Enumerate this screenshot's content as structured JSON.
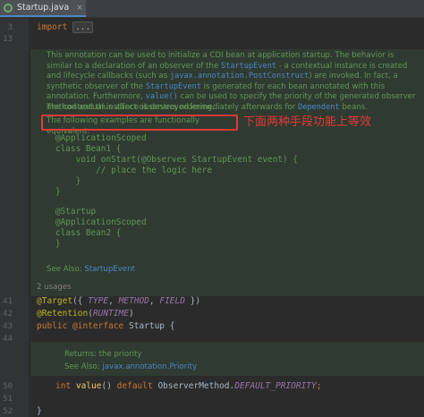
{
  "tab": {
    "label": "Startup.java",
    "close": "×"
  },
  "lines": {
    "l3": "3",
    "l13": "13",
    "l41": "41",
    "l42": "42",
    "l43": "43",
    "l44": "44",
    "l50": "50",
    "l51": "51",
    "l52": "52"
  },
  "code": {
    "import_kw": "import",
    "import_fold": "...",
    "target_ann": "@Target",
    "target_open": "({ ",
    "type": "TYPE",
    "comma1": ", ",
    "method": "METHOD",
    "comma2": ", ",
    "field": "FIELD",
    "target_close": " })",
    "retention_ann": "@Retention",
    "retention_open": "(",
    "runtime": "RUNTIME",
    "retention_close": ")",
    "public_kw": "public ",
    "interface_kw": "@interface ",
    "startup_name": "Startup {",
    "int_kw": "int ",
    "value_fn": "value",
    "value_rest": "() ",
    "default_kw": "default ",
    "observer": "ObserverMethod.",
    "default_priority": "DEFAULT_PRIORITY",
    "semi": ";",
    "close_brace": "}"
  },
  "doc": {
    "p1_a": "This annotation can be used to initialize a CDI bean at application startup. The behavior is similar to a declaration of an observer of the ",
    "p1_code1": "StartupEvent",
    "p1_b": " - a contextual instance is created and lifecycle callbacks (such as ",
    "p1_code2": "javax.annotation.PostConstruct",
    "p1_c": ") are invoked. In fact, a synthetic observer of the ",
    "p1_code3": "StartupEvent",
    "p1_d": " is generated for each bean annotated with this annotation. Furthermore, ",
    "p1_code4": "value()",
    "p1_e": " can be used to specify the priority of the generated observer method and thus affect observers ordering.",
    "p2_a": "The contextual instance is destroyed immediately afterwards for ",
    "p2_code": "Dependent",
    "p2_b": " beans.",
    "p3": "The following examples are functionally equivalent.",
    "ex1": [
      "@ApplicationScoped",
      "class Bean1 {",
      "    void onStart(@Observes StartupEvent event) {",
      "        // place the logic here",
      "    }",
      "}"
    ],
    "ex2": [
      "@Startup",
      "@ApplicationScoped",
      "class Bean2 {",
      "}"
    ],
    "see_also_label": "See Also: ",
    "see_also_link": "StartupEvent",
    "returns_label": "Returns: ",
    "returns_text": " the priority",
    "see_also2_label": "See Also: ",
    "see_also2_link": "javax.annotation.Priority"
  },
  "annotation_note": "下面两种手段功能上等效",
  "usages": "2 usages",
  "colors": {
    "keyword": "#cc7832",
    "annotation": "#bbb529",
    "constant": "#9876aa",
    "doc": "#629755",
    "link": "#4a88c7",
    "highlight": "#e53935"
  }
}
